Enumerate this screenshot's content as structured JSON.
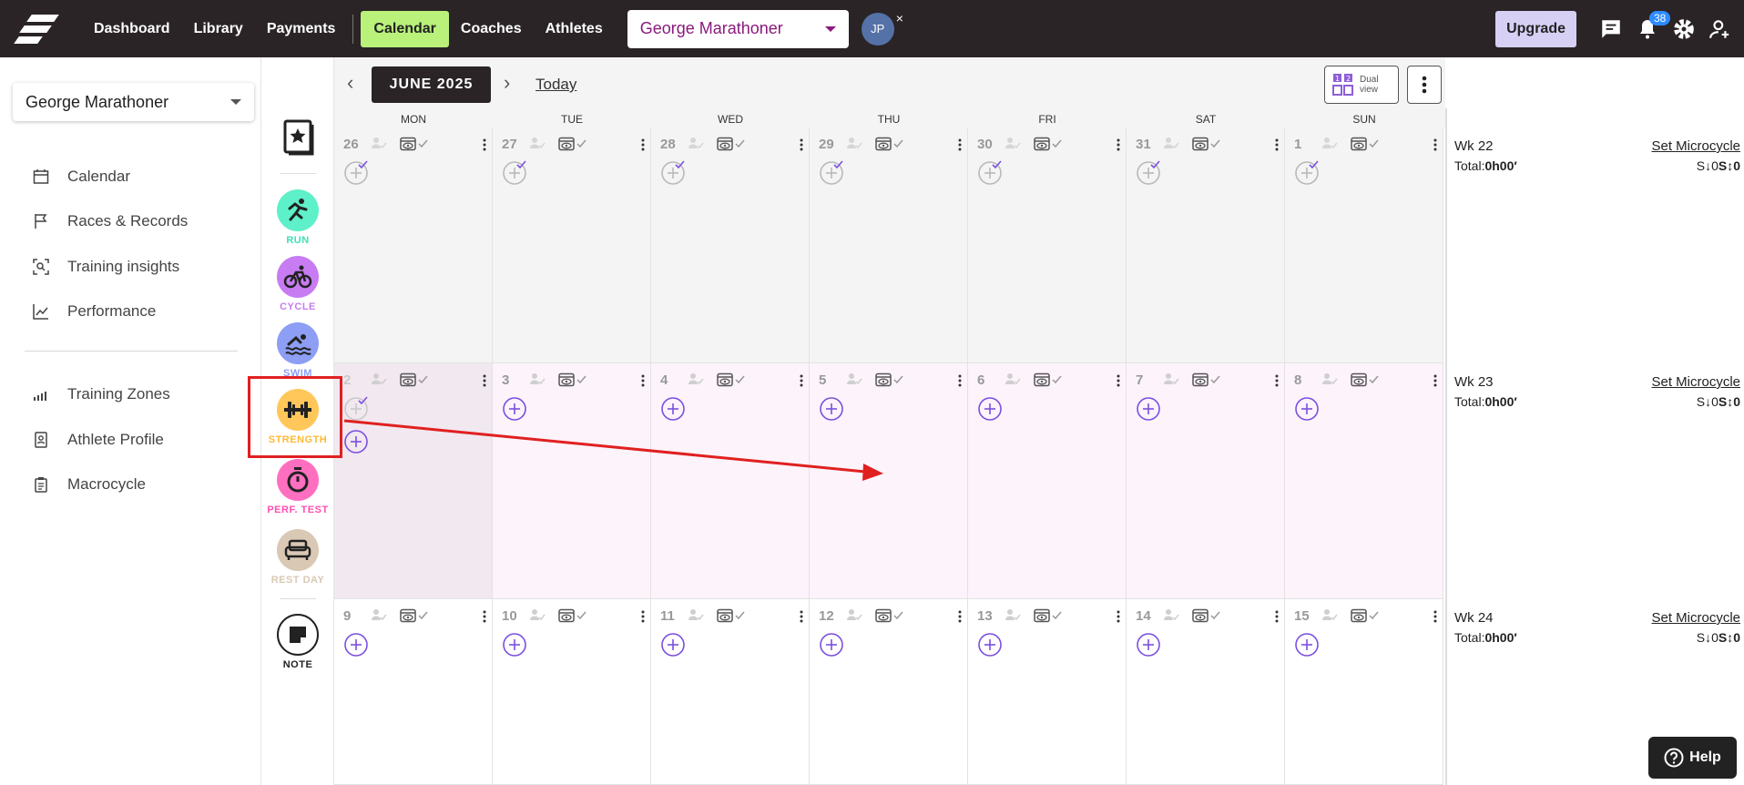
{
  "nav": {
    "links": [
      "Dashboard",
      "Library",
      "Payments"
    ],
    "active": "Calendar",
    "links2": [
      "Coaches",
      "Athletes"
    ],
    "athlete_select": "George Marathoner",
    "avatar": "JP",
    "avatar_close": "×",
    "upgrade": "Upgrade",
    "notification_count": "38"
  },
  "sidebar": {
    "athlete_select": "George Marathoner",
    "items": [
      "Calendar",
      "Races & Records",
      "Training insights",
      "Performance"
    ],
    "items2": [
      "Training Zones",
      "Athlete Profile",
      "Macrocycle"
    ]
  },
  "palette": {
    "run": "RUN",
    "cycle": "CYCLE",
    "swim": "SWIM",
    "strength": "STRENGTH",
    "perf_test": "PERF. TEST",
    "rest_day": "REST DAY",
    "note": "NOTE",
    "colors": {
      "run": "#5ef0c8",
      "cycle": "#c77cf2",
      "swim": "#8d9ef4",
      "strength": "#ffc75a",
      "perf_test": "#ff6fc0",
      "rest_day": "#d9c8b4"
    }
  },
  "calendar": {
    "month": "JUNE 2025",
    "today": "Today",
    "dual_view_line1": "Dual",
    "dual_view_line2": "view",
    "days_of_week": [
      "MON",
      "TUE",
      "WED",
      "THU",
      "FRI",
      "SAT",
      "SUN"
    ],
    "weeks": [
      {
        "days": [
          "26",
          "27",
          "28",
          "29",
          "30",
          "31",
          "1"
        ],
        "label": "Wk 22",
        "total_label": "Total:",
        "total": "0h00′",
        "set": "Set Microcycle",
        "stress": "S↓0",
        "stress2": "S↕0"
      },
      {
        "days": [
          "2",
          "3",
          "4",
          "5",
          "6",
          "7",
          "8"
        ],
        "label": "Wk 23",
        "total_label": "Total:",
        "total": "0h00′",
        "set": "Set Microcycle",
        "stress": "S↓0",
        "stress2": "S↕0"
      },
      {
        "days": [
          "9",
          "10",
          "11",
          "12",
          "13",
          "14",
          "15"
        ],
        "label": "Wk 24",
        "total_label": "Total:",
        "total": "0h00′",
        "set": "Set Microcycle",
        "stress": "S↓0",
        "stress2": "S↕0"
      }
    ]
  },
  "help": "Help"
}
